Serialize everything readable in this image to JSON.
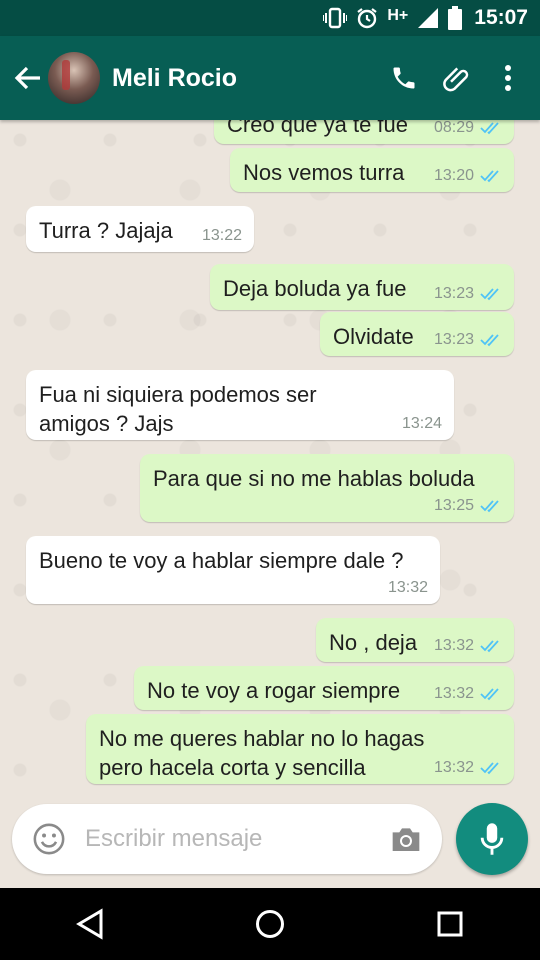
{
  "status_bar": {
    "network": "H+",
    "time": "15:07"
  },
  "header": {
    "contact_name": "Meli Rocio"
  },
  "messages": [
    {
      "dir": "out",
      "text": "Creo que ya te fue",
      "time": "08:29",
      "read": true
    },
    {
      "dir": "out",
      "text": "Nos vemos turra",
      "time": "13:20",
      "read": true
    },
    {
      "dir": "in",
      "text": "Turra ? Jajaja",
      "time": "13:22"
    },
    {
      "dir": "out",
      "text": "Deja boluda ya fue",
      "time": "13:23",
      "read": true
    },
    {
      "dir": "out",
      "text": "Olvidate",
      "time": "13:23",
      "read": true
    },
    {
      "dir": "in",
      "text": "Fua ni siquiera podemos ser\namigos ? Jajs",
      "time": "13:24"
    },
    {
      "dir": "out",
      "text": "Para que si no me hablas boluda",
      "time": "13:25",
      "read": true
    },
    {
      "dir": "in",
      "text": "Bueno te voy a hablar siempre dale ?",
      "time": "13:32"
    },
    {
      "dir": "out",
      "text": "No , deja",
      "time": "13:32",
      "read": true
    },
    {
      "dir": "out",
      "text": "No te voy a rogar siempre",
      "time": "13:32",
      "read": true
    },
    {
      "dir": "out",
      "text": "No me queres hablar no lo hagas\npero hacela corta y sencilla",
      "time": "13:32",
      "read": true
    }
  ],
  "composer": {
    "placeholder": "Escribir mensaje"
  },
  "colors": {
    "header": "#075e54",
    "status_bar": "#054d44",
    "outgoing": "#dcf8c6",
    "incoming": "#ffffff",
    "tick": "#4fc3f7",
    "mic": "#128c7e"
  },
  "icons": [
    "vibrate-icon",
    "alarm-icon",
    "signal-icon",
    "battery-icon",
    "back-arrow-icon",
    "phone-icon",
    "attach-icon",
    "more-vert-icon",
    "emoji-icon",
    "camera-icon",
    "mic-icon",
    "nav-back-icon",
    "nav-home-icon",
    "nav-recents-icon"
  ]
}
